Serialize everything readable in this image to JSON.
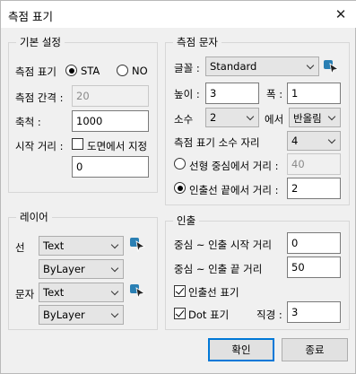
{
  "title": "측점 표기",
  "basic": {
    "legend": "기본 설정",
    "station_label": "측점 표기",
    "sta_label": "STA",
    "no_label": "NO",
    "interval_label": "측점 간격 :",
    "interval_value": "20",
    "scale_label": "축척 :",
    "scale_value": "1000",
    "start_label": "시작 거리 :",
    "from_drawing_label": "도면에서 지정",
    "start_value": "0"
  },
  "text": {
    "legend": "측점 문자",
    "font_label": "글꼴 :",
    "font_value": "Standard",
    "height_label": "높이 :",
    "height_value": "3",
    "width_label": "폭 :",
    "width_value": "1",
    "decimal_label": "소수",
    "decimal_value": "2",
    "at_label": "에서",
    "rounding_value": "반올림",
    "station_decimal_label": "측점 표기 소수 자리",
    "station_decimal_value": "4",
    "linear_label": "선형 중심에서 거리 :",
    "linear_value": "40",
    "leader_end_label": "인출선 끝에서 거리 :",
    "leader_end_value": "2"
  },
  "layer": {
    "legend": "레이어",
    "line_label": "선",
    "line_value": "Text",
    "line_color": "ByLayer",
    "text_label": "문자",
    "text_value": "Text",
    "text_color": "ByLayer"
  },
  "leader": {
    "legend": "인출",
    "start_label": "중심 ~ 인출 시작 거리",
    "start_value": "0",
    "end_label": "중심 ~ 인출 끝 거리",
    "end_value": "50",
    "show_leader_label": "인출선 표기",
    "dot_label": "Dot 표기",
    "diameter_label": "직경 :",
    "diameter_value": "3"
  },
  "buttons": {
    "ok": "확인",
    "close": "종료"
  }
}
